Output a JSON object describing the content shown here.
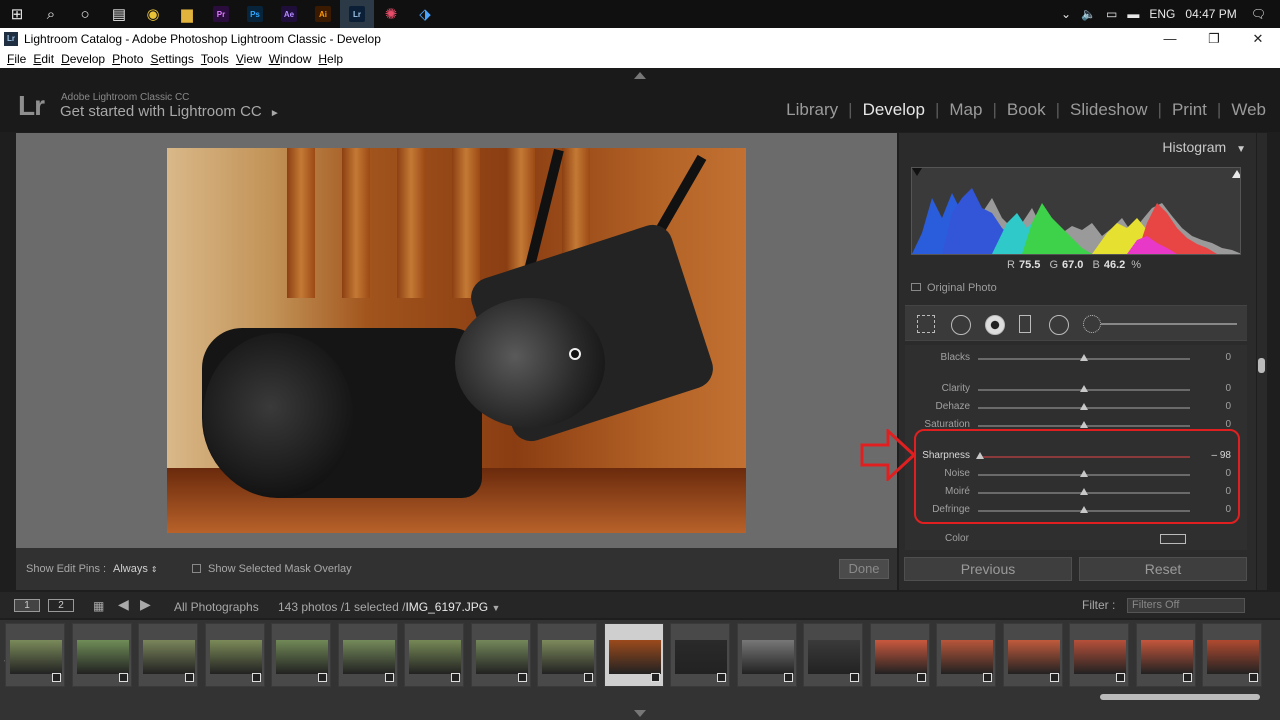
{
  "window": {
    "title": "Lightroom Catalog - Adobe Photoshop Lightroom Classic - Develop",
    "app_icon": "Lr"
  },
  "menu": [
    "File",
    "Edit",
    "Develop",
    "Photo",
    "Settings",
    "Tools",
    "View",
    "Window",
    "Help"
  ],
  "taskbar": {
    "lang": "ENG",
    "time": "04:47 PM",
    "apps": [
      "Pr",
      "Ps",
      "Ae",
      "Ai",
      "Lr"
    ]
  },
  "identity": {
    "logo": "Lr",
    "subtitle": "Adobe Lightroom Classic CC",
    "main": "Get started with Lightroom CC",
    "main_arrow": "►"
  },
  "modules": [
    "Library",
    "Develop",
    "Map",
    "Book",
    "Slideshow",
    "Print",
    "Web"
  ],
  "active_module": "Develop",
  "histogram": {
    "title": "Histogram",
    "r_label": "R",
    "r_value": "75.5",
    "g_label": "G",
    "g_value": "67.0",
    "b_label": "B",
    "b_value": "46.2",
    "percent": "%",
    "original_photo": "Original Photo"
  },
  "adjustments": [
    {
      "label": "Blacks",
      "value": "0",
      "position": 0.5
    },
    {
      "label": "Clarity",
      "value": "0",
      "position": 0.5
    },
    {
      "label": "Dehaze",
      "value": "0",
      "position": 0.5
    },
    {
      "label": "Saturation",
      "value": "0",
      "position": 0.5
    },
    {
      "label": "Sharpness",
      "value": "– 98",
      "position": 0.01
    },
    {
      "label": "Noise",
      "value": "0",
      "position": 0.5
    },
    {
      "label": "Moiré",
      "value": "0",
      "position": 0.5
    },
    {
      "label": "Defringe",
      "value": "0",
      "position": 0.5
    }
  ],
  "color_label": "Color",
  "buttons": {
    "previous": "Previous",
    "reset": "Reset",
    "done": "Done"
  },
  "toolbar": {
    "show_edit_pins_label": "Show Edit Pins :",
    "show_edit_pins_value": "Always",
    "mask_overlay_label": "Show Selected Mask Overlay"
  },
  "filmstrip": {
    "page1": "1",
    "page2": "2",
    "source": "All Photographs",
    "count": "143 photos /1 selected /",
    "filename": "IMG_6197.JPG",
    "filter_label": "Filter :",
    "filter_value": "Filters Off"
  }
}
